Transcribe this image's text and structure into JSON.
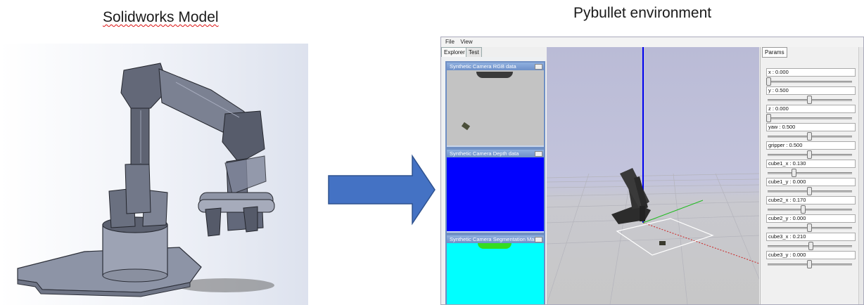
{
  "slide": {
    "left_title": "Solidworks Model",
    "right_title": "Pybullet environment"
  },
  "pybullet": {
    "menu": [
      "File",
      "View"
    ],
    "tabs": [
      "Explorer",
      "Test"
    ],
    "params_tab": "Params",
    "cameras": [
      {
        "title": "Synthetic Camera RGB data",
        "color": "#c3c3c3"
      },
      {
        "title": "Synthetic Camera Depth data",
        "color": "#0000ff"
      },
      {
        "title": "Synthetic Camera Segmentation Mask",
        "color": "#00ffff"
      }
    ],
    "params": [
      {
        "label": "x : 0.000",
        "value": 0.0
      },
      {
        "label": "y : 0.500",
        "value": 0.5
      },
      {
        "label": "z : 0.000",
        "value": 0.0
      },
      {
        "label": "yaw : 0.500",
        "value": 0.5
      },
      {
        "label": "gripper : 0.500",
        "value": 0.5
      },
      {
        "label": "cube1_x : 0.130",
        "value": 0.3
      },
      {
        "label": "cube1_y : 0.000",
        "value": 0.5
      },
      {
        "label": "cube2_x : 0.170",
        "value": 0.42
      },
      {
        "label": "cube2_y : 0.000",
        "value": 0.5
      },
      {
        "label": "cube3_x : 0.210",
        "value": 0.52
      },
      {
        "label": "cube3_y : 0.000",
        "value": 0.5
      }
    ]
  }
}
